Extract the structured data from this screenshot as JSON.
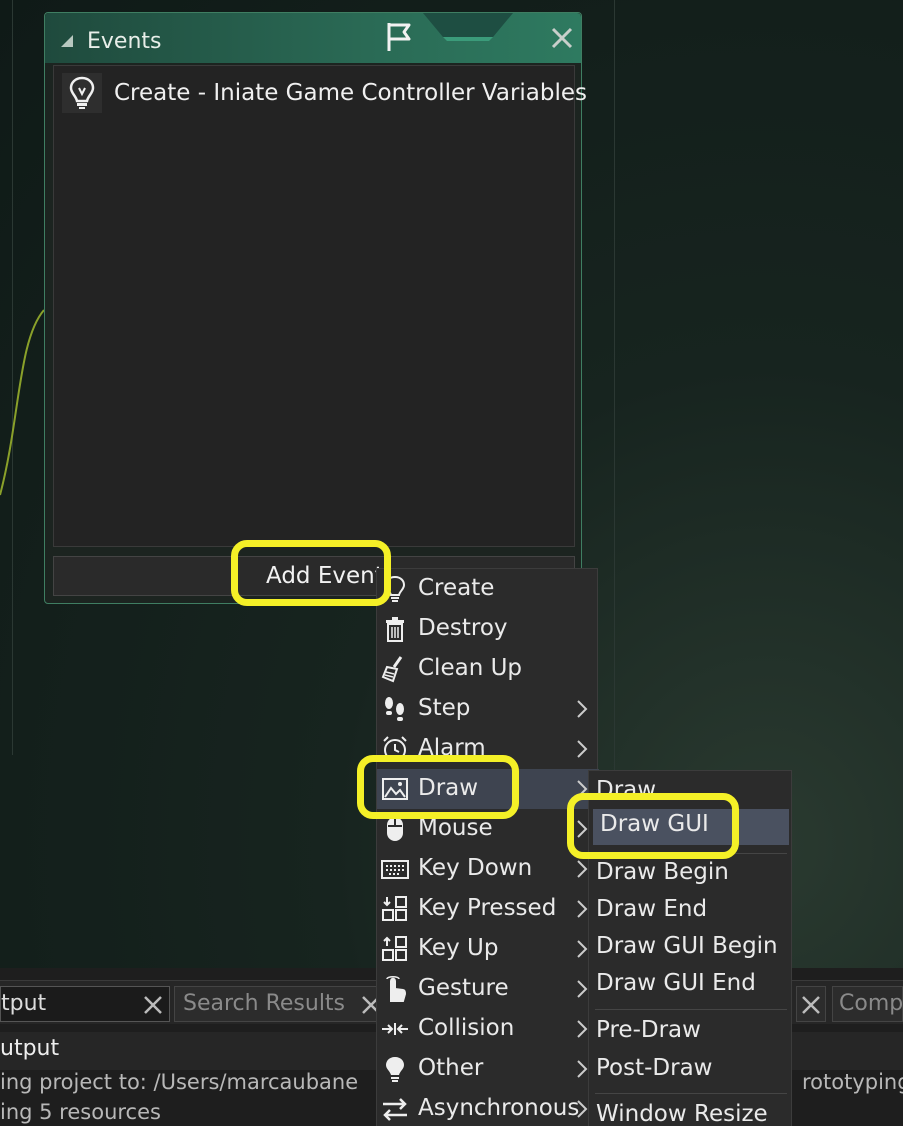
{
  "events_window": {
    "title": "Events",
    "events": [
      {
        "icon": "lightbulb-icon",
        "label": "Create - Iniate Game Controller Variables"
      }
    ],
    "add_event_label": "Add Event"
  },
  "context_menu": {
    "items": [
      {
        "icon": "lightbulb-icon",
        "label": "Create",
        "has_submenu": false
      },
      {
        "icon": "trash-icon",
        "label": "Destroy",
        "has_submenu": false
      },
      {
        "icon": "broom-icon",
        "label": "Clean Up",
        "has_submenu": false
      },
      {
        "icon": "footsteps-icon",
        "label": "Step",
        "has_submenu": true
      },
      {
        "icon": "alarm-clock-icon",
        "label": "Alarm",
        "has_submenu": true
      },
      {
        "icon": "picture-icon",
        "label": "Draw",
        "has_submenu": true,
        "active": true
      },
      {
        "icon": "mouse-icon",
        "label": "Mouse",
        "has_submenu": true
      },
      {
        "icon": "keyboard-icon",
        "label": "Key Down",
        "has_submenu": true
      },
      {
        "icon": "key-pressed-icon",
        "label": "Key Pressed",
        "has_submenu": true
      },
      {
        "icon": "key-up-icon",
        "label": "Key Up",
        "has_submenu": true
      },
      {
        "icon": "gesture-hand-icon",
        "label": "Gesture",
        "has_submenu": true
      },
      {
        "icon": "collision-arrows-icon",
        "label": "Collision",
        "has_submenu": true
      },
      {
        "icon": "other-bulb-icon",
        "label": "Other",
        "has_submenu": true
      },
      {
        "icon": "swap-arrows-icon",
        "label": "Asynchronous",
        "has_submenu": true
      }
    ]
  },
  "draw_submenu": {
    "items": [
      {
        "label": "Draw"
      },
      {
        "label": "Draw GUI",
        "active": true
      },
      {
        "label": "Draw Begin"
      },
      {
        "label": "Draw End"
      },
      {
        "label": "Draw GUI Begin"
      },
      {
        "label": "Draw GUI End"
      },
      {
        "label": "Pre-Draw"
      },
      {
        "label": "Post-Draw"
      },
      {
        "label": "Window Resize"
      }
    ]
  },
  "bottom_panel": {
    "tabs": [
      {
        "label": "tput",
        "active": true
      },
      {
        "label": "Search Results",
        "active": false
      },
      {
        "label": "Comp",
        "active": false
      }
    ],
    "output_title": "utput",
    "log_lines": [
      "ing project to: /Users/marcaubane",
      "rototyping",
      "ing 5 resources"
    ]
  },
  "colors": {
    "highlight": "#f4f027",
    "header_green": "#2a6a55",
    "menu_bg": "#2b2b2b",
    "menu_active": "#3e4450"
  }
}
